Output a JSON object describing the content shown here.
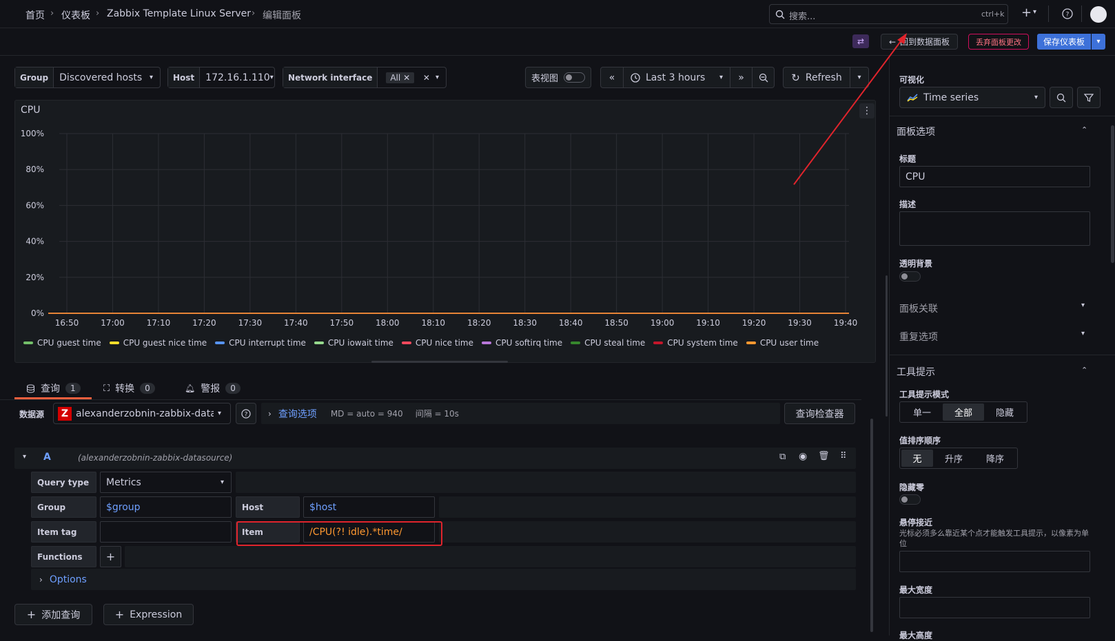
{
  "breadcrumb": {
    "home": "首页",
    "dashboards": "仪表板",
    "dashboard": "Zabbix Template Linux Server",
    "current": "编辑面板"
  },
  "search": {
    "placeholder": "搜索...",
    "shortcut": "ctrl+k"
  },
  "edit_toolbar": {
    "back_label": "回到数据面板",
    "discard_label": "丢弃面板更改",
    "save_label": "保存仪表板"
  },
  "variables": {
    "group": {
      "label": "Group",
      "value": "Discovered hosts"
    },
    "host": {
      "label": "Host",
      "value": "172.16.1.110"
    },
    "network": {
      "label": "Network interface",
      "value": "All"
    }
  },
  "time_controls": {
    "table_view_label": "表视图",
    "range": "Last 3 hours",
    "refresh": "Refresh"
  },
  "panel": {
    "title": "CPU",
    "y_ticks": [
      "100%",
      "80%",
      "60%",
      "40%",
      "20%",
      "0%"
    ],
    "x_ticks": [
      "16:50",
      "17:00",
      "17:10",
      "17:20",
      "17:30",
      "17:40",
      "17:50",
      "18:00",
      "18:10",
      "18:20",
      "18:30",
      "18:40",
      "18:50",
      "19:00",
      "19:10",
      "19:20",
      "19:30",
      "19:40"
    ]
  },
  "chart_data": {
    "type": "line",
    "title": "CPU",
    "x": [
      "16:50",
      "17:00",
      "17:10",
      "17:20",
      "17:30",
      "17:40",
      "17:50",
      "18:00",
      "18:10",
      "18:20",
      "18:30",
      "18:40",
      "18:50",
      "19:00",
      "19:10",
      "19:20",
      "19:30",
      "19:40"
    ],
    "ylim": [
      0,
      100
    ],
    "y_unit": "%",
    "grid": true,
    "legend_position": "bottom",
    "series": [
      {
        "name": "CPU guest time",
        "color": "#73bf69",
        "values": [
          0,
          0,
          0,
          0,
          0,
          0,
          0,
          0,
          0,
          0,
          0,
          0,
          0,
          0,
          0,
          0,
          0,
          0
        ]
      },
      {
        "name": "CPU guest nice time",
        "color": "#fade2a",
        "values": [
          0,
          0,
          0,
          0,
          0,
          0,
          0,
          0,
          0,
          0,
          0,
          0,
          0,
          0,
          0,
          0,
          0,
          0
        ]
      },
      {
        "name": "CPU interrupt time",
        "color": "#5794f2",
        "values": [
          0,
          0,
          0,
          0,
          0,
          0,
          0,
          0,
          0,
          0,
          0,
          0,
          0,
          0,
          0,
          0,
          0,
          0
        ]
      },
      {
        "name": "CPU iowait time",
        "color": "#96d98d",
        "values": [
          0,
          0,
          0,
          0,
          0,
          0,
          0,
          0,
          0,
          0,
          0,
          0,
          0,
          0,
          0,
          0,
          0,
          0
        ]
      },
      {
        "name": "CPU nice time",
        "color": "#f2495c",
        "values": [
          0,
          0,
          0,
          0,
          0,
          0,
          0,
          0,
          0,
          0,
          0,
          0,
          0,
          0,
          0,
          0,
          0,
          0
        ]
      },
      {
        "name": "CPU softirq time",
        "color": "#b877d9",
        "values": [
          0,
          0,
          0,
          0,
          0,
          0,
          0,
          0,
          0,
          0,
          0,
          0,
          0,
          0,
          0,
          0,
          0,
          0
        ]
      },
      {
        "name": "CPU steal time",
        "color": "#37872d",
        "values": [
          0,
          0,
          0,
          0,
          0,
          0,
          0,
          0,
          0,
          0,
          0,
          0,
          0,
          0,
          0,
          0,
          0,
          0
        ]
      },
      {
        "name": "CPU system time",
        "color": "#c4162a",
        "values": [
          0,
          0,
          0,
          0,
          0,
          0,
          0,
          0,
          0,
          0,
          0,
          0,
          0,
          0,
          0,
          0,
          0,
          0
        ]
      },
      {
        "name": "CPU user time",
        "color": "#ff9830",
        "values": [
          0,
          0,
          0,
          0,
          0,
          0,
          0,
          0,
          0,
          0,
          0,
          0,
          0,
          0,
          0,
          0,
          0,
          0
        ]
      }
    ]
  },
  "tabs": [
    {
      "label": "查询",
      "count": "1"
    },
    {
      "label": "转换",
      "count": "0"
    },
    {
      "label": "警报",
      "count": "0"
    }
  ],
  "query": {
    "datasource_label": "数据源",
    "datasource_value": "alexanderzobnin-zabbix-datasource",
    "options_label": "查询选项",
    "options_meta": "MD = auto = 940",
    "interval_meta": "间隔 = 10s",
    "inspector_label": "查询检查器",
    "ref_id": "A",
    "ref_source": "(alexanderzobnin-zabbix-datasource)",
    "query_type_label": "Query type",
    "query_type_value": "Metrics",
    "group_label": "Group",
    "group_value": "$group",
    "host_label": "Host",
    "host_value": "$host",
    "item_tag_label": "Item tag",
    "item_label": "Item",
    "item_value": "/CPU(?! idle).*time/",
    "functions_label": "Functions",
    "options_row_label": "Options",
    "add_query_label": "添加查询",
    "expression_label": "Expression"
  },
  "right_panel": {
    "visualization_label": "可视化",
    "visualization_value": "Time series",
    "panel_options_title": "面板选项",
    "title_label": "标题",
    "title_value": "CPU",
    "description_label": "描述",
    "transparent_label": "透明背景",
    "panel_links_label": "面板关联",
    "repeat_label": "重复选项",
    "tooltip_title": "工具提示",
    "tooltip_mode_label": "工具提示模式",
    "tooltip_modes": [
      "单一",
      "全部",
      "隐藏"
    ],
    "sort_label": "值排序顺序",
    "sort_options": [
      "无",
      "升序",
      "降序"
    ],
    "hide_zero_label": "隐藏零",
    "hover_label": "悬停接近",
    "hover_desc": "光标必须多么靠近某个点才能触发工具提示，以像素为单位",
    "max_width_label": "最大宽度",
    "max_height_label": "最大高度"
  }
}
